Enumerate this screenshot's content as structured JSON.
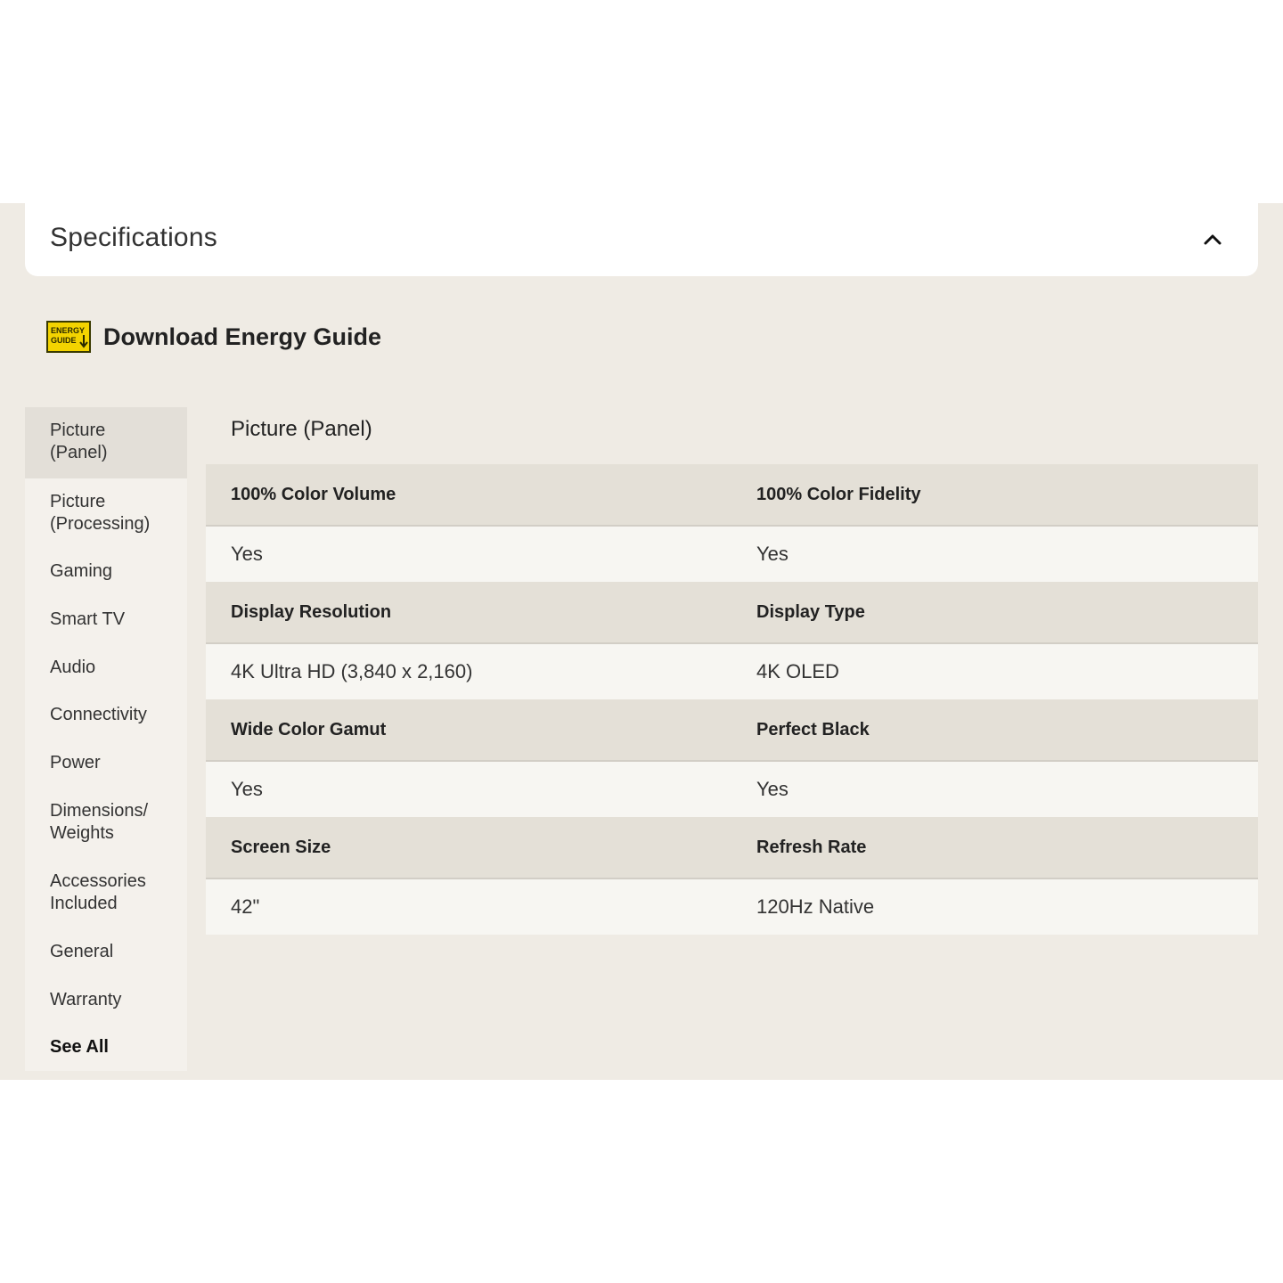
{
  "header": {
    "title": "Specifications",
    "collapse_icon": "chevron-up-icon"
  },
  "energy_guide": {
    "label": "Download Energy Guide",
    "icon": "energy-guide-icon",
    "icon_text_1": "ENERGY",
    "icon_text_2": "GUIDE",
    "icon_color": "#f3d300"
  },
  "sidebar": {
    "items": [
      {
        "line1": "Picture",
        "line2": "(Panel)"
      },
      {
        "line1": "Picture",
        "line2": "(Processing)"
      },
      {
        "line1": "Gaming",
        "line2": ""
      },
      {
        "line1": "Smart TV",
        "line2": ""
      },
      {
        "line1": "Audio",
        "line2": ""
      },
      {
        "line1": "Connectivity",
        "line2": ""
      },
      {
        "line1": "Power",
        "line2": ""
      },
      {
        "line1": "Dimensions/",
        "line2": "Weights"
      },
      {
        "line1": "Accessories",
        "line2": "Included"
      },
      {
        "line1": "General",
        "line2": ""
      },
      {
        "line1": "Warranty",
        "line2": ""
      },
      {
        "line1": "See All",
        "line2": ""
      }
    ],
    "active_index": 0
  },
  "content": {
    "title": "Picture (Panel)",
    "rows": [
      {
        "h1": "100% Color Volume",
        "h2": "100% Color Fidelity",
        "v1": "Yes",
        "v2": "Yes"
      },
      {
        "h1": "Display Resolution",
        "h2": "Display Type",
        "v1": "4K Ultra HD (3,840 x 2,160)",
        "v2": "4K OLED"
      },
      {
        "h1": "Wide Color Gamut",
        "h2": "Perfect Black",
        "v1": "Yes",
        "v2": "Yes"
      },
      {
        "h1": "Screen Size",
        "h2": "Refresh Rate",
        "v1": "42\"",
        "v2": "120Hz Native"
      }
    ]
  },
  "colors": {
    "panel_bg": "#efebe4",
    "header_row_bg": "#e4e0d7",
    "value_row_bg": "#f7f6f2",
    "sidebar_active_bg": "#e3dfd8"
  }
}
